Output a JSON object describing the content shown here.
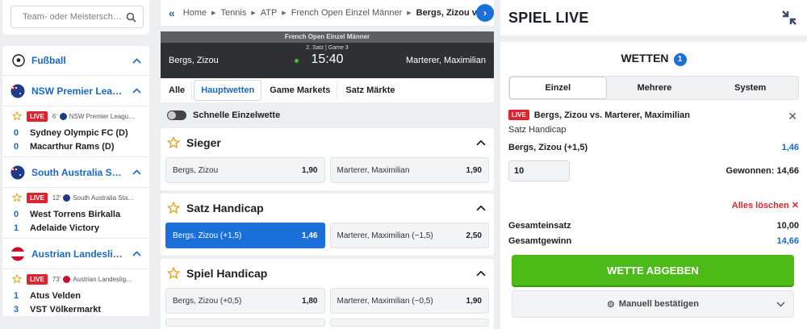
{
  "search": {
    "placeholder": "Team- oder Meistersch…"
  },
  "sport": {
    "label": "Fußball"
  },
  "leagues": [
    {
      "label": "NSW Premier Lea…",
      "minute": "6'",
      "comp": "NSW Premier Leagu…",
      "teams": [
        {
          "score": "0",
          "name": "Sydney Olympic FC (D)"
        },
        {
          "score": "0",
          "name": "Macarthur Rams (D)"
        }
      ]
    },
    {
      "label": "South Australia S…",
      "minute": "12'",
      "comp": "South Australia Sta…",
      "teams": [
        {
          "score": "0",
          "name": "West Torrens Birkalla"
        },
        {
          "score": "1",
          "name": "Adelaide Victory"
        }
      ]
    },
    {
      "label": "Austrian Landesli…",
      "minute": "73'",
      "comp": "Austrian Landeslig…",
      "teams": [
        {
          "score": "1",
          "name": "Atus Velden"
        },
        {
          "score": "3",
          "name": "VST Völkermarkt"
        }
      ]
    }
  ],
  "live_label": "LIVE",
  "breadcrumb": {
    "items": [
      "Home",
      "Tennis",
      "ATP",
      "French Open Einzel Männer"
    ],
    "current": "Bergs, Zizou vs. M…"
  },
  "scoreboard": {
    "competition": "French Open Einzel Männer",
    "info": "2. Satz  |  Game 3",
    "time": "15:40",
    "home": "Bergs, Zizou",
    "away": "Marterer, Maximilian"
  },
  "tabs": [
    "Alle",
    "Hauptwetten",
    "Game Markets",
    "Satz Märkte"
  ],
  "quick_bet": "Schnelle Einzelwette",
  "markets": [
    {
      "title": "Sieger",
      "odds": [
        {
          "label": "Bergs, Zizou",
          "value": "1,90"
        },
        {
          "label": "Marterer, Maximilian",
          "value": "1,90"
        }
      ]
    },
    {
      "title": "Satz Handicap",
      "odds": [
        {
          "label": "Bergs, Zizou (+1,5)",
          "value": "1,46"
        },
        {
          "label": "Marterer, Maximilian (−1,5)",
          "value": "2,50"
        }
      ]
    },
    {
      "title": "Spiel Handicap",
      "odds": [
        {
          "label": "Bergs, Zizou (+0,5)",
          "value": "1,80"
        },
        {
          "label": "Marterer, Maximilian (−0,5)",
          "value": "1,90"
        }
      ]
    }
  ],
  "right": {
    "title": "SPIEL LIVE",
    "wetten": "WETTEN",
    "count": "1",
    "bet_tabs": [
      "Einzel",
      "Mehrere",
      "System"
    ],
    "slip": {
      "event": "Bergs, Zizou vs. Marterer, Maximilian",
      "market": "Satz Handicap",
      "selection": "Bergs, Zizou (+1,5)",
      "odds": "1,46",
      "stake": "10",
      "winnings": "Gewonnen: 14,66"
    },
    "clear_all": "Alles löschen",
    "total_stake_label": "Gesamteinsatz",
    "total_stake": "10,00",
    "total_win_label": "Gesamtgewinn",
    "total_win": "14,66",
    "place_bet": "WETTE ABGEBEN",
    "confirm": "Manuell bestätigen"
  },
  "colors": {
    "accent": "#1a6fd8",
    "live": "#e0242f",
    "place_bet": "#4cbb17"
  }
}
